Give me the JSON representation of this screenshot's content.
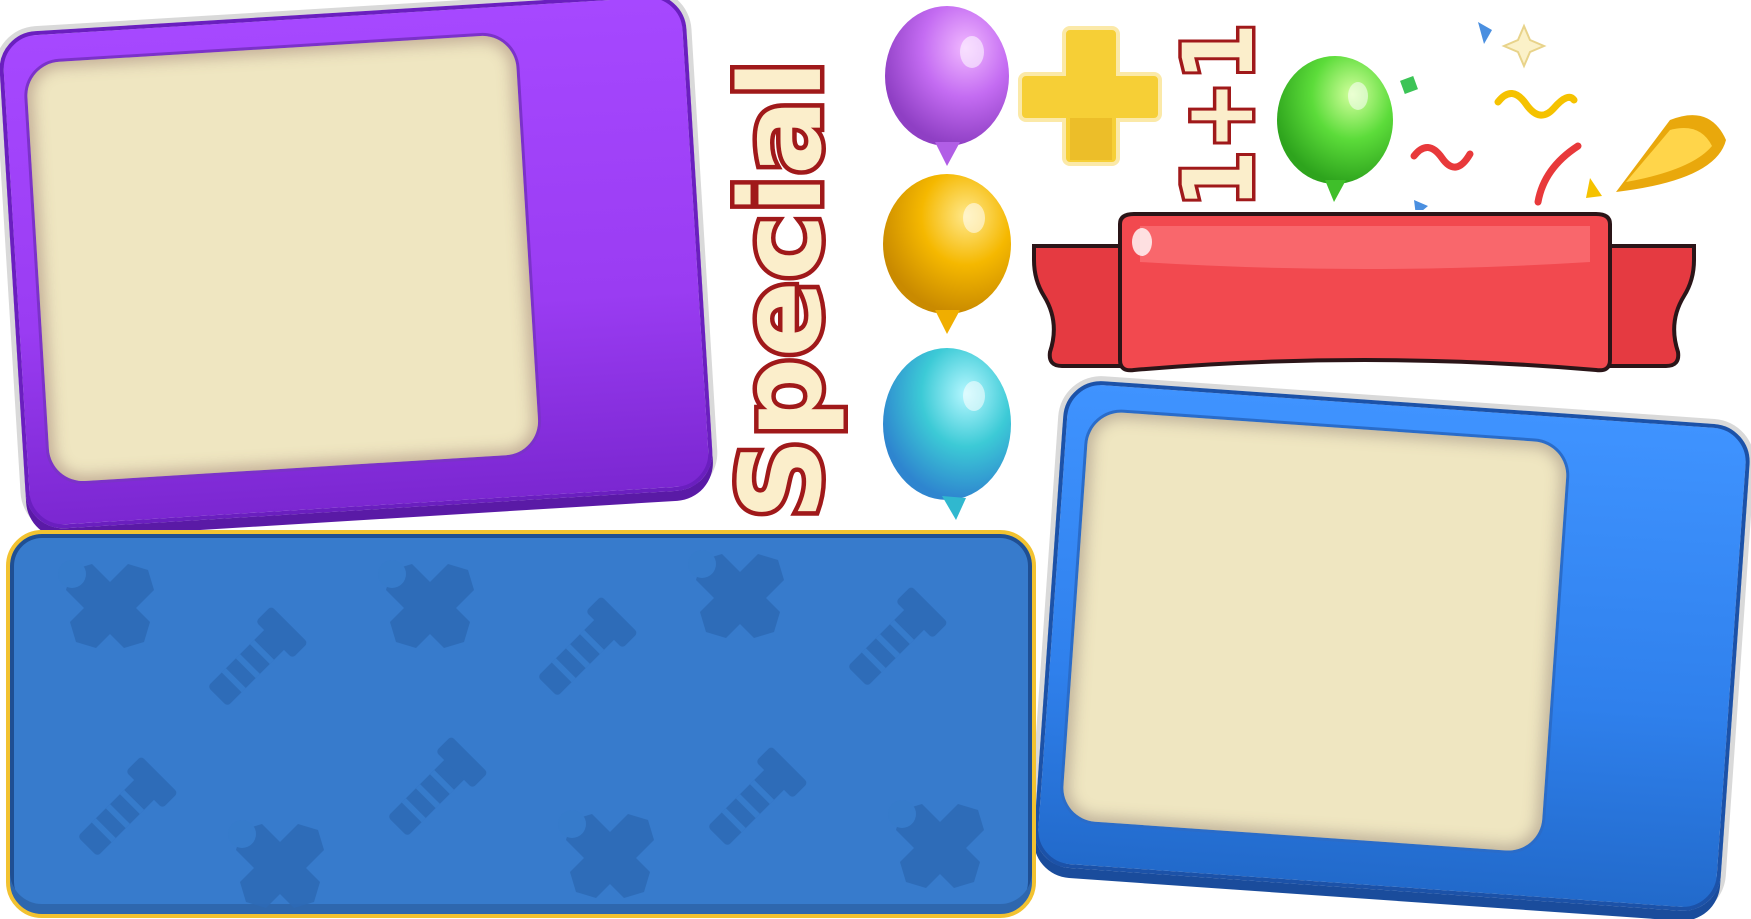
{
  "title_word": "Special",
  "counter_badge": "1+1",
  "colors": {
    "purple": "#a648ff",
    "blue": "#3f93ff",
    "panel_blue": "#377bcc",
    "cream": "#efe6c1",
    "ribbon_red": "#f2494f",
    "gold": "#f5b800",
    "text_fill": "#fbeecb",
    "text_outline": "#a0191a"
  },
  "balloons": [
    {
      "color_name": "purple",
      "color": "#c46cf2"
    },
    {
      "color_name": "yellow",
      "color": "#f5b800"
    },
    {
      "color_name": "cyan",
      "color": "#3ccad6"
    },
    {
      "color_name": "green",
      "color": "#5cdc3a"
    }
  ],
  "icons": [
    "plus-icon",
    "party-horn-icon",
    "sparkle-icon",
    "wrench-icon",
    "bolt-icon"
  ]
}
